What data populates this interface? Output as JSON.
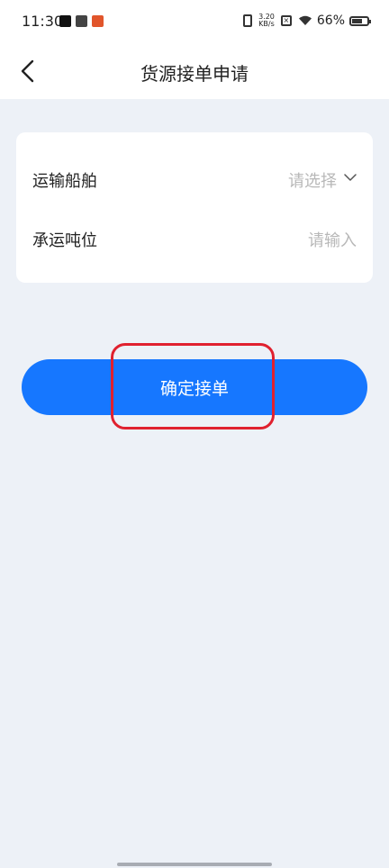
{
  "status_bar": {
    "time": "11:30",
    "net_speed_value": "3.20",
    "net_speed_unit": "KB/s",
    "battery_percent": "66%"
  },
  "header": {
    "title": "货源接单申请",
    "back_icon": "chevron-left-icon"
  },
  "form": {
    "ship": {
      "label": "运输船舶",
      "placeholder": "请选择",
      "icon": "chevron-down-icon"
    },
    "tonnage": {
      "label": "承运吨位",
      "placeholder": "请输入"
    }
  },
  "actions": {
    "confirm_label": "确定接单"
  },
  "colors": {
    "accent": "#1677ff",
    "background": "#edf1f7",
    "highlight": "#e0212f"
  }
}
